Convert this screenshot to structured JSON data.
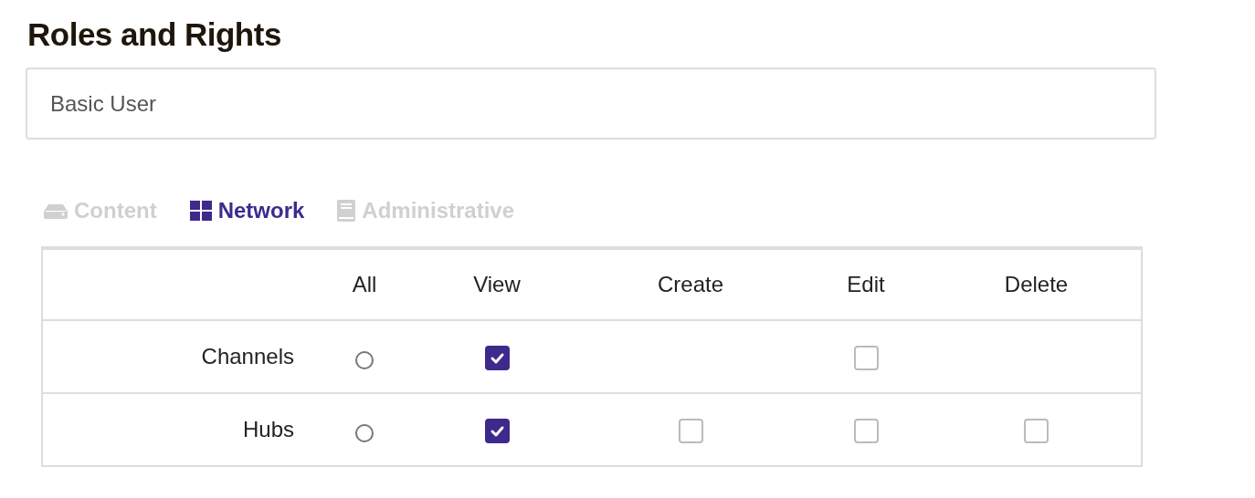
{
  "title": "Roles and Rights",
  "role_field": {
    "value": "Basic User"
  },
  "tabs": [
    {
      "label": "Content",
      "selected": false
    },
    {
      "label": "Network",
      "selected": true
    },
    {
      "label": "Administrative",
      "selected": false
    }
  ],
  "table": {
    "columns": [
      "All",
      "View",
      "Create",
      "Edit",
      "Delete"
    ],
    "rows": [
      {
        "label": "Channels",
        "cells": [
          {
            "kind": "radio",
            "checked": false
          },
          {
            "kind": "checkbox",
            "checked": true
          },
          {
            "kind": "blank"
          },
          {
            "kind": "checkbox",
            "checked": false
          },
          {
            "kind": "blank"
          }
        ]
      },
      {
        "label": "Hubs",
        "cells": [
          {
            "kind": "radio",
            "checked": false
          },
          {
            "kind": "checkbox",
            "checked": true
          },
          {
            "kind": "checkbox",
            "checked": false
          },
          {
            "kind": "checkbox",
            "checked": false
          },
          {
            "kind": "checkbox",
            "checked": false
          }
        ]
      }
    ]
  }
}
